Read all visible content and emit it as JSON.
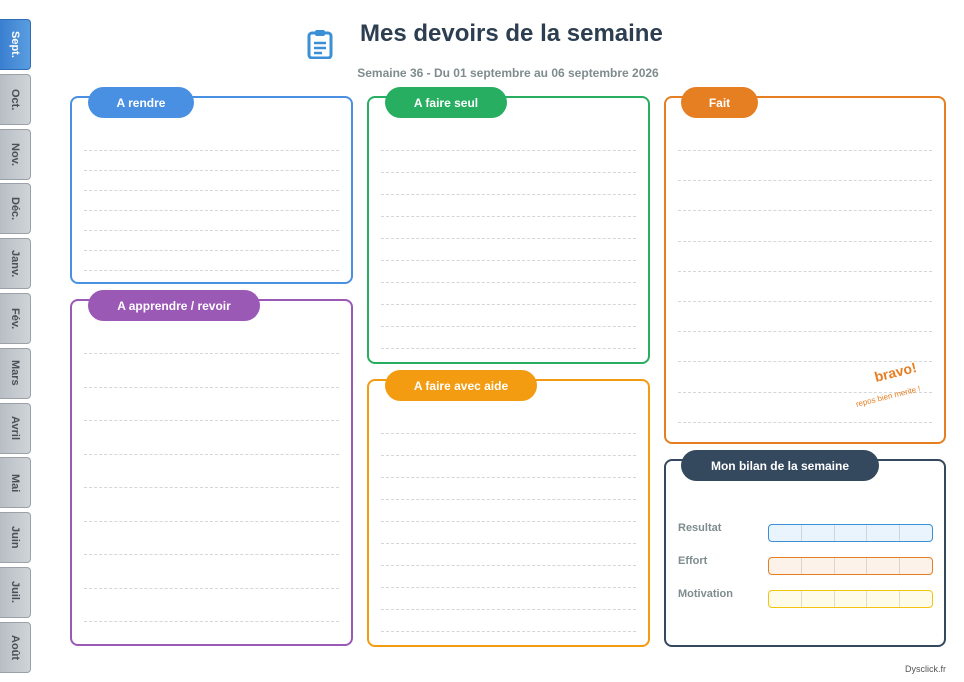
{
  "months": [
    "Sept.",
    "Oct.",
    "Nov.",
    "Déc.",
    "Janv.",
    "Fév.",
    "Mars",
    "Avril",
    "Mai",
    "Juin",
    "Juil.",
    "Août"
  ],
  "active_month": "Sept.",
  "header": {
    "icon": "clipboard-icon",
    "title": "Mes devoirs de la semaine",
    "subtitle": "Semaine 36 - Du 01 septembre au 06 septembre 2026"
  },
  "sections": {
    "a_rendre": {
      "label": "A rendre",
      "color": "#4a90e2"
    },
    "a_apprendre": {
      "label": "A apprendre / revoir",
      "color": "#9b59b6"
    },
    "a_faire_seul": {
      "label": "A faire seul",
      "color": "#27ae60"
    },
    "a_faire_aide": {
      "label": "A faire avec aide",
      "color": "#f39c12"
    },
    "fait": {
      "label": "Fait",
      "color": "#e67e22",
      "bravo": "bravo!",
      "repos": "repos bien merite !"
    },
    "bilan": {
      "label": "Mon bilan de la semaine",
      "color": "#34495e",
      "rows": [
        {
          "label": "Resultat",
          "color": "#3a8fd6",
          "fill": "#eaf4fc"
        },
        {
          "label": "Effort",
          "color": "#e67e22",
          "fill": "#fdf2e9"
        },
        {
          "label": "Motivation",
          "color": "#f1c40f",
          "fill": "#fefbe8"
        }
      ]
    }
  },
  "footer": "Dysclick.fr"
}
